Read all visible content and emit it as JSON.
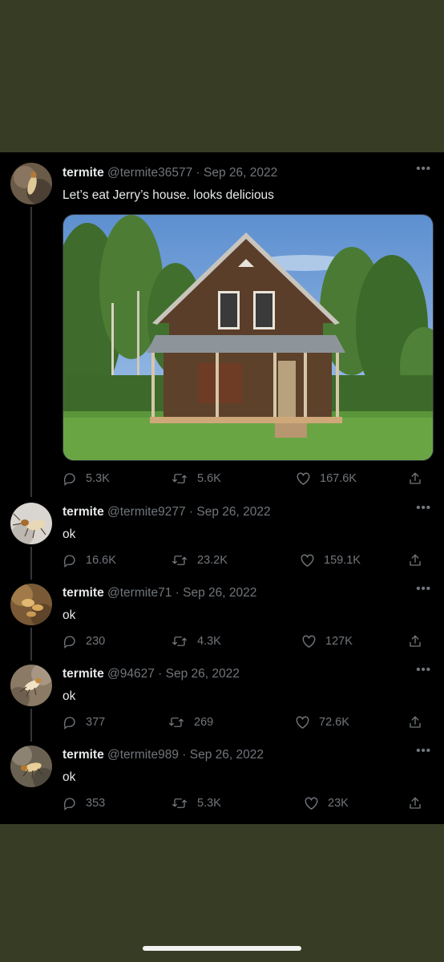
{
  "thread": {
    "tweets": [
      {
        "display_name": "termite",
        "handle": "@termite36577",
        "date": "Sep 26, 2022",
        "text": "Let’s eat Jerry’s house. looks delicious",
        "has_image": true,
        "image_desc": "old wooden house",
        "replies": "5.3K",
        "retweets": "5.6K",
        "likes": "167.6K"
      },
      {
        "display_name": "termite",
        "handle": "@termite9277",
        "date": "Sep 26, 2022",
        "text": "ok",
        "replies": "16.6K",
        "retweets": "23.2K",
        "likes": "159.1K"
      },
      {
        "display_name": "termite",
        "handle": "@termite71",
        "date": "Sep 26, 2022",
        "text": "ok",
        "replies": "230",
        "retweets": "4.3K",
        "likes": "127K"
      },
      {
        "display_name": "termite",
        "handle": "@94627",
        "date": "Sep 26, 2022",
        "text": "ok",
        "replies": "377",
        "retweets": "269",
        "likes": "72.6K"
      },
      {
        "display_name": "termite",
        "handle": "@termite989",
        "date": "Sep 26, 2022",
        "text": "ok",
        "replies": "353",
        "retweets": "5.3K",
        "likes": "23K"
      }
    ]
  },
  "separator": "·",
  "more_label": "•••",
  "icons": {
    "reply": "reply-icon",
    "retweet": "retweet-icon",
    "like": "heart-icon",
    "share": "share-icon",
    "more": "more-options-icon"
  },
  "colors": {
    "background_band": "#373d24",
    "thread_bg": "#000000",
    "text_primary": "#e7e9ea",
    "text_secondary": "#71767b"
  }
}
